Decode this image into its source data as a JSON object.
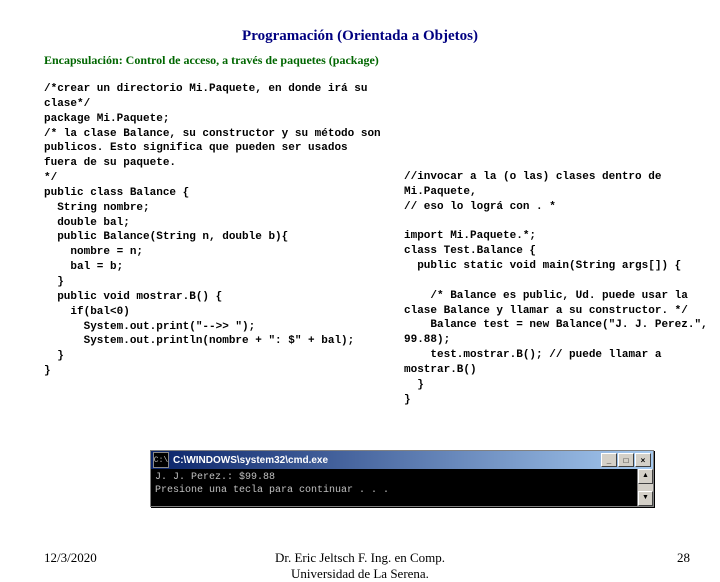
{
  "title": "Programación (Orientada a Objetos)",
  "subtitle": "Encapsulación: Control de acceso, a través de paquetes (package)",
  "code_left": "/*crear un directorio Mi.Paquete, en donde irá su clase*/\npackage Mi.Paquete;\n/* la clase Balance, su constructor y su método son publicos. Esto significa que pueden ser usados  fuera de su paquete.\n*/\npublic class Balance {\n  String nombre;\n  double bal;\n  public Balance(String n, double b){\n    nombre = n;\n    bal = b;\n  }\n  public void mostrar.B() {\n    if(bal<0)\n      System.out.print(\"-->> \");\n      System.out.println(nombre + \": $\" + bal);\n  }\n}",
  "code_right": "//invocar a la (o las) clases dentro de Mi.Paquete,\n// eso lo lográ con . *\n\nimport Mi.Paquete.*;\nclass Test.Balance {\n  public static void main(String args[]) {\n\n    /* Balance es public, Ud. puede usar la clase Balance y llamar a su constructor. */\n    Balance test = new Balance(\"J. J. Perez.\", 99.88);\n    test.mostrar.B(); // puede llamar a mostrar.B()\n  }\n}",
  "cmd": {
    "title": "C:\\WINDOWS\\system32\\cmd.exe",
    "line1": "J. J. Perez.: $99.88",
    "line2": "Presione una tecla para continuar . . ."
  },
  "footer": {
    "date": "12/3/2020",
    "center1": "Dr. Eric Jeltsch F. Ing. en Comp.",
    "center2": "Universidad de La Serena.",
    "page": "28"
  },
  "icons": {
    "min": "_",
    "max": "□",
    "close": "×",
    "up": "▲",
    "down": "▼",
    "cmd": "C:\\"
  }
}
